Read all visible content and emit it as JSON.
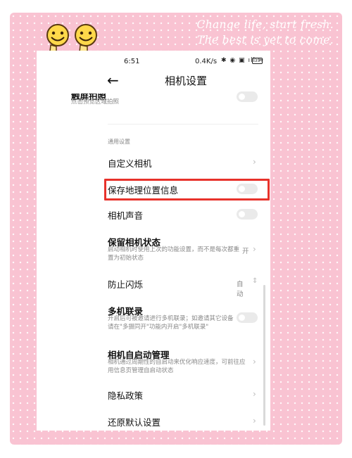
{
  "decoration": {
    "tagline_line1": "Change life, start fresh.",
    "tagline_line2": "The best is yet to come.",
    "frame_color": "#f9c3d2",
    "highlight_color": "#e8322b"
  },
  "status_bar": {
    "time": "6:51",
    "network_speed": "0.4K/s",
    "icons": "✱ ◉ ▣ ıll ≈",
    "battery": "35"
  },
  "header": {
    "back_icon": "←",
    "title": "相机设置"
  },
  "settings": {
    "touch_capture": {
      "label": "触屏拍照",
      "description": "点击预览区域拍照",
      "enabled": false
    },
    "section_general": "通用设置",
    "custom_camera": {
      "label": "自定义相机"
    },
    "save_location": {
      "label": "保存地理位置信息",
      "enabled": false
    },
    "camera_sound": {
      "label": "相机声音",
      "enabled": false
    },
    "keep_state": {
      "label": "保留相机状态",
      "description": "启动相机时使用上次的功能设置，而不是每次都重置为初始状态",
      "value": "开"
    },
    "anti_flicker": {
      "label": "防止闪烁",
      "value": "自动"
    },
    "multi_camera": {
      "label": "多机联录",
      "description": "开启后可被邀请进行多机联录；如邀请其它设备请在\"多摄同开\"功能内开启\"多机联录\"",
      "enabled": false
    },
    "auto_start": {
      "label": "相机自启动管理",
      "description": "相机通过周期性的自启动来优化响应速度，可前往应用信息页管理自启动状态"
    },
    "privacy": {
      "label": "隐私政策"
    },
    "reset": {
      "label": "还原默认设置"
    }
  }
}
